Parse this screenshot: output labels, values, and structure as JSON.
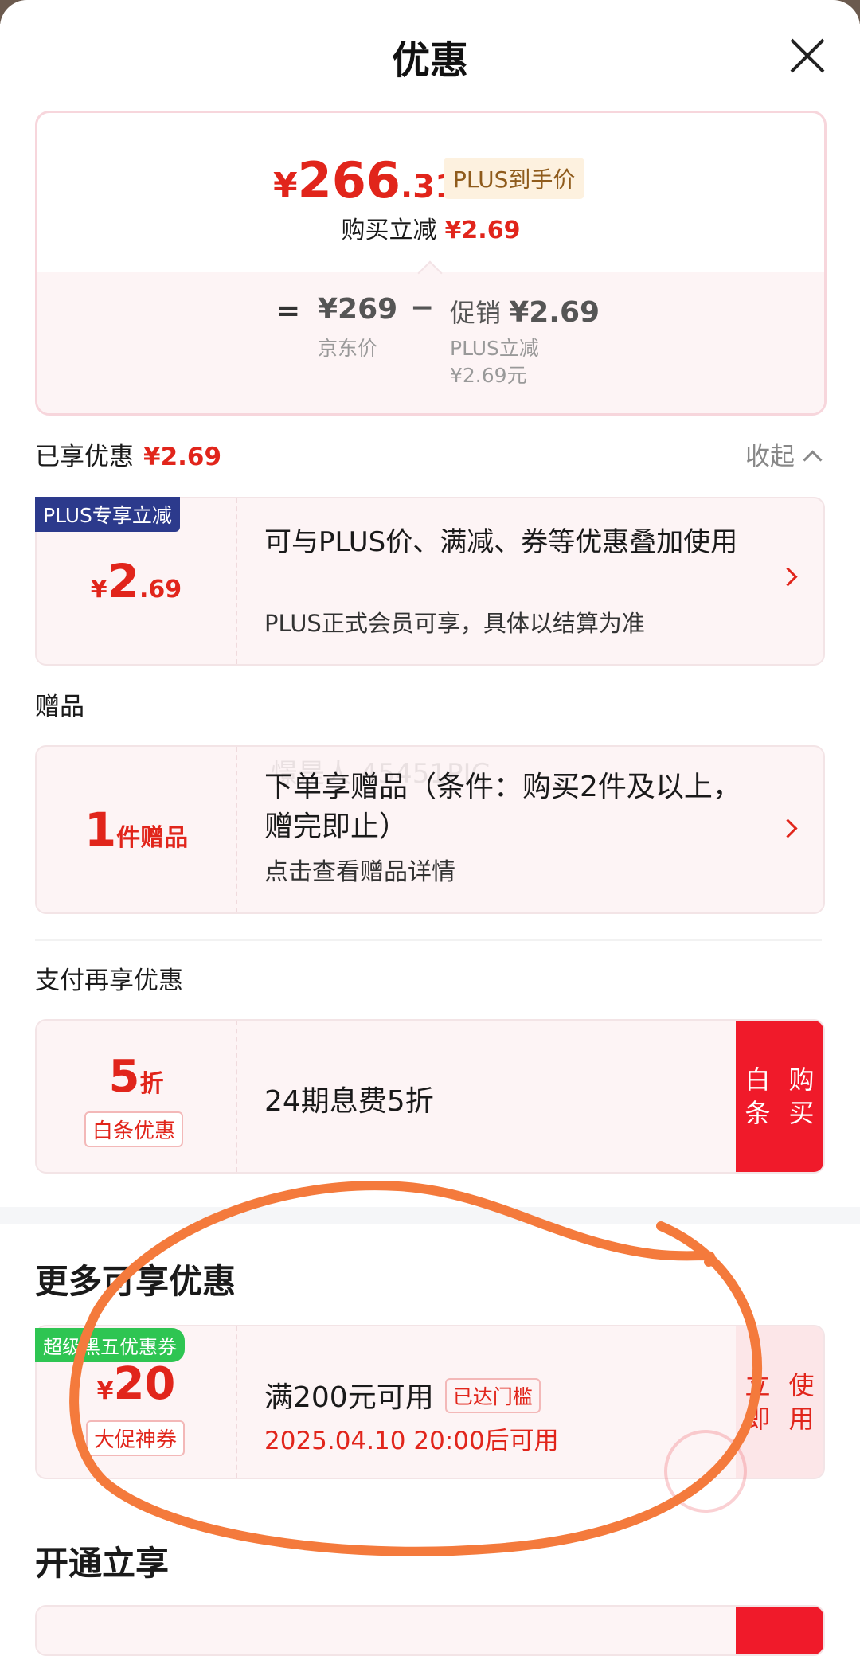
{
  "header": {
    "title": "优惠"
  },
  "price_summary": {
    "currency": "¥",
    "price_int": "266",
    "price_dec": ".31",
    "plus_tag": "PLUS到手价",
    "buy_reduce_label": "购买立减",
    "buy_reduce_amount": "¥2.69",
    "eq_sign": "=",
    "jd_price": "¥269",
    "jd_price_label": "京东价",
    "minus_sign": "−",
    "promo_label": "促销",
    "promo_amount": "¥2.69",
    "plus_reduce_label": "PLUS立减",
    "plus_reduce_value": "¥2.69元"
  },
  "enjoyed": {
    "label": "已享优惠",
    "amount": "¥2.69",
    "collapse": "收起"
  },
  "plus_card": {
    "badge": "PLUS专享立减",
    "yen": "¥",
    "int": "2",
    "dec": ".69",
    "line1": "可与PLUS价、满减、券等优惠叠加使用",
    "line2": "PLUS正式会员可享，具体以结算为准"
  },
  "gift": {
    "section_label": "赠品",
    "count": "1",
    "unit": "件赠品",
    "line1": "下单享赠品（条件：购买2件及以上，赠完即止）",
    "line2": "点击查看赠品详情",
    "watermark": "憬是人 45451PIC"
  },
  "payment": {
    "section_label": "支付再享优惠",
    "discount_num": "5",
    "discount_unit": "折",
    "tag": "白条优惠",
    "line1": "24期息费5折",
    "button": "白条购买"
  },
  "more": {
    "section_label": "更多可享优惠",
    "badge": "超级黑五优惠券",
    "yen": "¥",
    "amount": "20",
    "tag": "大促神券",
    "line1": "满200元可用",
    "reached": "已达门槛",
    "line2": "2025.04.10 20:00后可用",
    "button": "立即使用"
  },
  "open": {
    "section_label": "开通立享"
  },
  "colors": {
    "accent": "#e1251b",
    "plus_navy": "#2c3a8c",
    "green_badge": "#2ec552",
    "scribble": "#f47a3c"
  }
}
